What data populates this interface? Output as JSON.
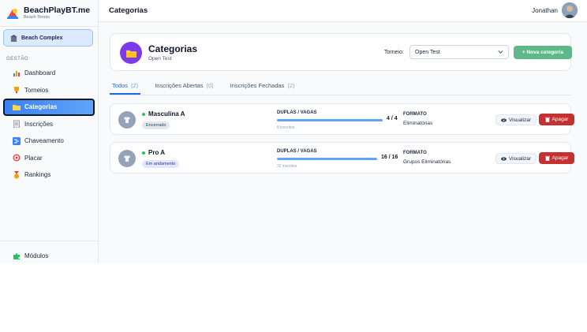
{
  "brand": {
    "title": "BeachPlayBT.me",
    "subtitle": "Beach Tennis"
  },
  "org": {
    "name": "Beach Complex"
  },
  "sidebar": {
    "section_label": "GESTÃO",
    "items": [
      {
        "label": "Dashboard",
        "icon": "chart-icon",
        "active": false
      },
      {
        "label": "Torneios",
        "icon": "trophy-icon",
        "active": false
      },
      {
        "label": "Categorias",
        "icon": "folder-icon",
        "active": true
      },
      {
        "label": "Inscrições",
        "icon": "clipboard-icon",
        "active": false
      },
      {
        "label": "Chaveamento",
        "icon": "bracket-icon",
        "active": false
      },
      {
        "label": "Placar",
        "icon": "target-icon",
        "active": false
      },
      {
        "label": "Rankings",
        "icon": "medal-icon",
        "active": false
      }
    ],
    "bottom_item": {
      "label": "Módulos",
      "icon": "puzzle-icon"
    }
  },
  "topbar": {
    "title": "Categorias",
    "user_name": "Jonathan"
  },
  "header": {
    "title": "Categorias",
    "subtitle": "Open Test",
    "torneio_label": "Torneio:",
    "torneio_selected": "Open Test",
    "new_button": "+ Nova categoria"
  },
  "tabs": [
    {
      "label": "Todos",
      "count": "(2)",
      "active": true
    },
    {
      "label": "Inscrições Abertas",
      "count": "(0)",
      "active": false
    },
    {
      "label": "Inscrições Fechadas",
      "count": "(2)",
      "active": false
    }
  ],
  "categories": [
    {
      "name": "Masculina A",
      "status": "Encerrado",
      "duplas_label": "DUPLAS / VAGAS",
      "duplas_count": "4 / 4",
      "fill": 1.0,
      "inscritos": "8 inscritos",
      "formato_label": "FORMATO",
      "formato": "Eliminatórias",
      "view_label": "Visualizar",
      "delete_label": "Apagar"
    },
    {
      "name": "Pro A",
      "status": "Em andamento",
      "duplas_label": "DUPLAS / VAGAS",
      "duplas_count": "16 / 16",
      "fill": 1.0,
      "inscritos": "32 inscritos",
      "formato_label": "FORMATO",
      "formato": "Grupos Eliminatórias",
      "view_label": "Visualizar",
      "delete_label": "Apagar"
    }
  ],
  "colors": {
    "accent": "#3b82f6",
    "success": "#5fb88a",
    "danger": "#c53030",
    "purple": "#7c3aed"
  }
}
